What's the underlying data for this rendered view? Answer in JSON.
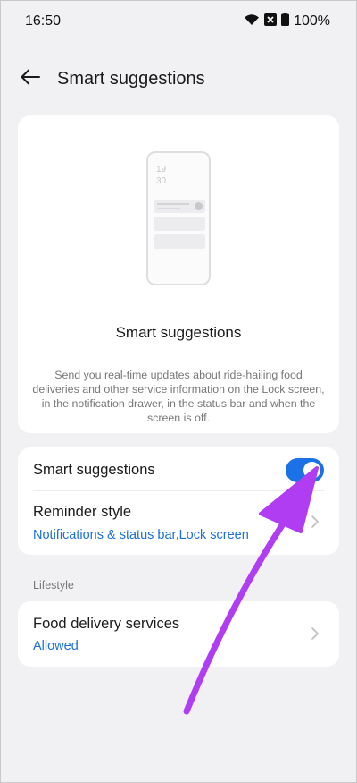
{
  "status": {
    "time": "16:50",
    "battery": "100%",
    "icons": [
      "wifi-icon",
      "signal-off-icon",
      "battery-icon"
    ]
  },
  "header": {
    "title": "Smart suggestions",
    "back_icon": "back-arrow-icon"
  },
  "hero": {
    "phone_time_line1": "19",
    "phone_time_line2": "30",
    "title": "Smart suggestions",
    "description": "Send you real-time updates about ride-hailing food deliveries and other service information on the Lock screen, in the notification drawer, in the status bar and when the screen is off."
  },
  "settings": {
    "smart_suggestions_label": "Smart suggestions",
    "smart_suggestions_enabled": true,
    "reminder_style_label": "Reminder style",
    "reminder_style_value": "Notifications & status bar,Lock screen"
  },
  "lifestyle": {
    "section_label": "Lifestyle",
    "food_delivery_label": "Food delivery services",
    "food_delivery_value": "Allowed"
  },
  "colors": {
    "accent": "#1a72e6",
    "link": "#1a6fd8",
    "annotation_arrow": "#b03df2",
    "background": "#f1f1f3"
  }
}
